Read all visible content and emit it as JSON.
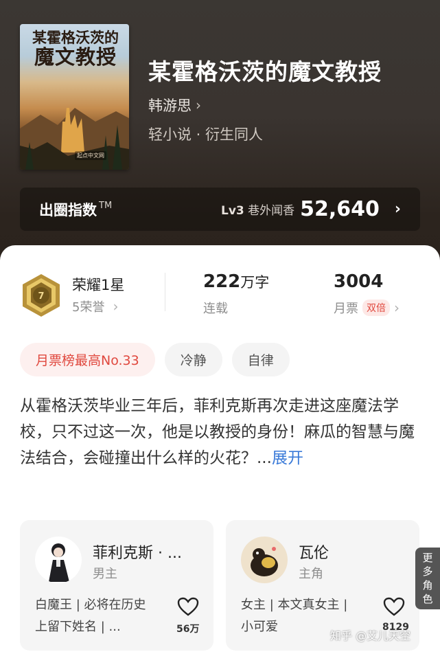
{
  "book": {
    "cover_text_line1": "某霍格沃茨的",
    "cover_text_line2": "魔文教授",
    "cover_publisher": "起点中文网",
    "title": "某霍格沃茨的魔文教授",
    "author": "韩游思",
    "genre": "轻小说 · 衍生同人"
  },
  "score": {
    "label": "出圈指数",
    "tm": "TM",
    "level": "Lv3",
    "level_text": "巷外闻香",
    "value": "52,640"
  },
  "stats": {
    "honor_title": "荣耀1星",
    "honor_sub": "5荣誉",
    "medal_number": "7",
    "words_num": "222",
    "words_unit": "万字",
    "status": "连载",
    "votes": "3004",
    "votes_label": "月票",
    "double_badge": "双倍"
  },
  "tags": [
    "月票榜最高No.33",
    "冷静",
    "自律"
  ],
  "synopsis": {
    "text": "从霍格沃茨毕业三年后，菲利克斯再次走进这座魔法学校，只不过这一次，他是以教授的身份！麻瓜的智慧与魔法结合，会碰撞出什么样的火花？...",
    "expand": "展开"
  },
  "characters": [
    {
      "name": "菲利克斯 · ...",
      "role": "男主",
      "desc": "白魔王 | 必将在历史上留下姓名 | ...",
      "likes": "56万"
    },
    {
      "name": "瓦伦",
      "role": "主角",
      "desc": "女主 | 本文真女主 | 小可爱",
      "likes": "8129"
    }
  ],
  "more_roles": [
    "更",
    "多",
    "角",
    "色"
  ],
  "watermark": "知乎 @艾儿天空",
  "colors": {
    "accent_red": "#e0483e",
    "link_blue": "#3a7ad8",
    "medal_gold": "#c9a646"
  }
}
